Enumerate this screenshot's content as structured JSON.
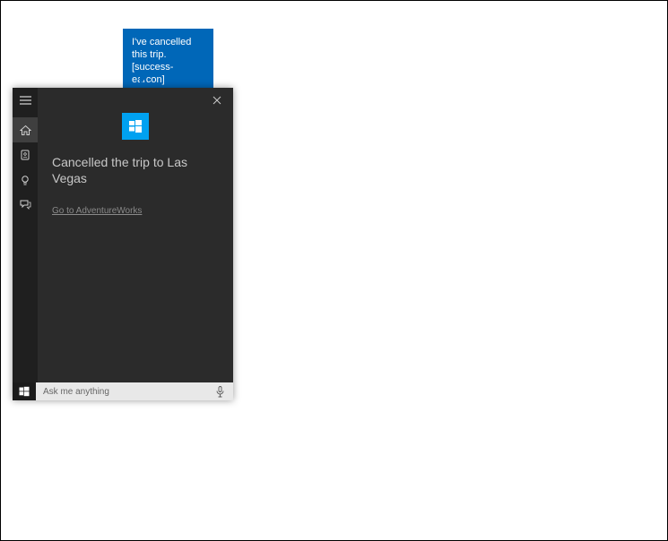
{
  "speech": {
    "line1": "I've cancelled",
    "line2": "this trip.",
    "line3": "[success-earcon]"
  },
  "panel": {
    "message": "Cancelled the trip to Las Vegas",
    "link": "Go to AdventureWorks"
  },
  "search": {
    "placeholder": "Ask me anything"
  }
}
